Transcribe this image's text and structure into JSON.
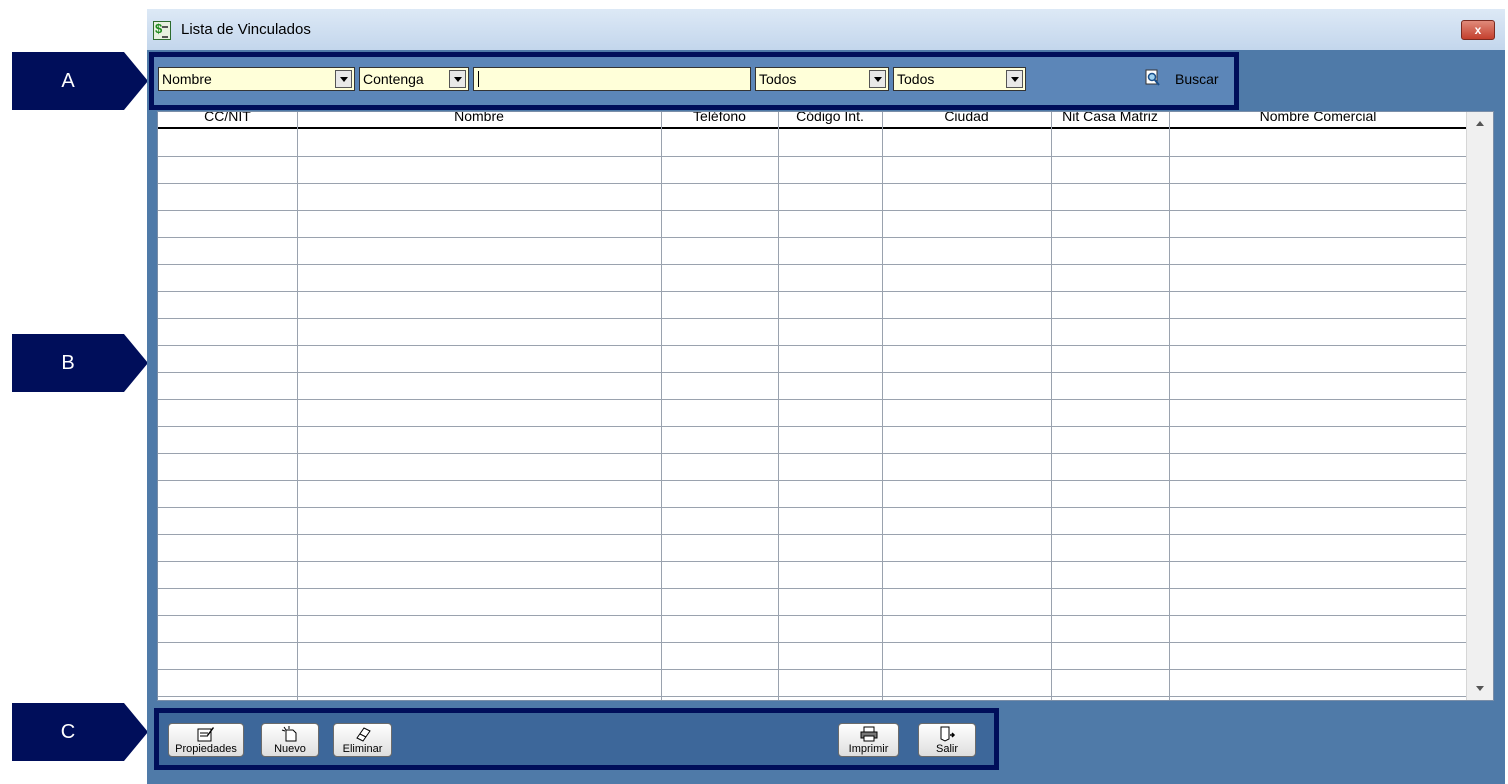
{
  "callouts": {
    "a": "A",
    "b": "B",
    "c": "C"
  },
  "window": {
    "title": "Lista de Vinculados",
    "close_label": "x"
  },
  "filters": {
    "field_select": "Nombre",
    "operator_select": "Contenga",
    "search_value": "",
    "filter1_select": "Todos",
    "filter2_select": "Todos",
    "search_button": "Buscar"
  },
  "table": {
    "columns": [
      "CC/NIT",
      "Nombre",
      "Teléfono",
      "Código Int.",
      "Ciudad",
      "Nit Casa Matriz",
      "Nombre Comercial"
    ],
    "rows": []
  },
  "buttons": {
    "propiedades": "Propiedades",
    "nuevo": "Nuevo",
    "eliminar": "Eliminar",
    "imprimir": "Imprimir",
    "salir": "Salir"
  },
  "colors": {
    "callout_bg": "#000e5a",
    "window_bg": "#4f7aa8",
    "input_bg": "#ffffd9"
  }
}
